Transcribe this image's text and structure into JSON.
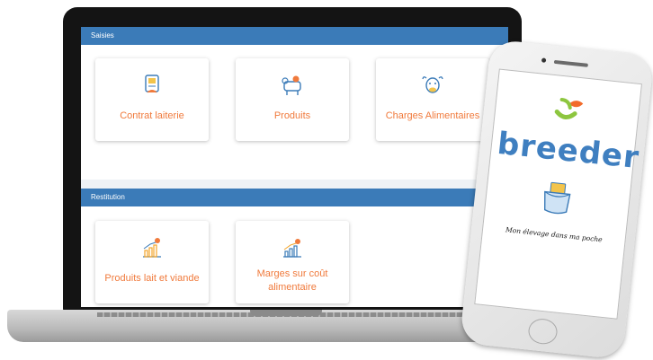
{
  "sections": {
    "saisies": {
      "title": "Saisies",
      "cards": [
        {
          "label": "Contrat laiterie",
          "icon": "milk-contract-icon"
        },
        {
          "label": "Produits",
          "icon": "cow-products-icon"
        },
        {
          "label": "Charges Alimentaires",
          "icon": "cow-feed-icon"
        }
      ]
    },
    "restitution": {
      "title": "Restitution",
      "cards": [
        {
          "label": "Produits lait et viande",
          "icon": "growth-chart-icon"
        },
        {
          "label_line1": "Marges sur coût",
          "label_line2": "alimentaire",
          "icon": "margin-chart-icon"
        }
      ]
    }
  },
  "phone": {
    "brand": "breeder",
    "tagline": "Mon élevage dans ma poche",
    "icons": [
      "breeder-logo-icon",
      "pocket-phone-icon"
    ]
  },
  "colors": {
    "header_blue": "#3b7bb8",
    "label_orange": "#f07a3c",
    "brand_blue": "#3f7fc0",
    "brand_green": "#8dc63f",
    "brand_orange": "#f26b2b"
  }
}
